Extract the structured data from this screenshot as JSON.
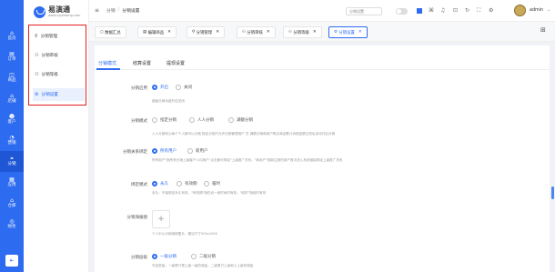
{
  "rail": {
    "items": [
      {
        "icon": "⌂",
        "label": "首页"
      },
      {
        "icon": "▤",
        "label": "订单"
      },
      {
        "icon": "◫",
        "label": "商品"
      },
      {
        "icon": "⌂",
        "label": "店铺"
      },
      {
        "icon": "☻",
        "label": "客户"
      },
      {
        "icon": "◔",
        "label": "营销"
      },
      {
        "icon": "⚭",
        "label": "分销"
      },
      {
        "icon": "▦",
        "label": "应用"
      },
      {
        "icon": "⌂",
        "label": "仓库"
      },
      {
        "icon": "◎",
        "label": "财务"
      }
    ],
    "bottom": "⇤"
  },
  "logo": {
    "title": "易演通",
    "sub": "www.yiyantong.com"
  },
  "sidebar": {
    "items": [
      {
        "icon": "⚲",
        "label": "分销管理"
      },
      {
        "icon": "⚇",
        "label": "分销审核"
      },
      {
        "icon": "⚇",
        "label": "分销等级"
      },
      {
        "icon": "⚙",
        "label": "分销设置"
      }
    ]
  },
  "topbar": {
    "menu_icon": "≡",
    "breadcrumb": [
      "分销",
      "分销设置"
    ],
    "search_placeholder": "分销设置",
    "user": "admin"
  },
  "tabs": [
    "数据汇总",
    "编辑商品",
    "分销管理",
    "分销审核",
    "分销等级",
    "分销设置"
  ],
  "page_tabs": [
    "分销模式",
    "结算设置",
    "提现设置"
  ],
  "form": {
    "enable": {
      "label": "分销启用",
      "options": [
        "开启",
        "关闭"
      ],
      "hint": "超级分销功能开启关闭"
    },
    "mode": {
      "label": "分销模式",
      "options": [
        "指定分销",
        "人人分销",
        "满额分销"
      ],
      "hint": "人人分销则公每个个人都可以分销 指定分销只允许分销管理用户 员 满额分销商用户购买商品累计消费金额达到后自动开启分销"
    },
    "relation": {
      "label": "分销关系绑定",
      "options": [
        "所有用户",
        "新用户"
      ],
      "hint": "所有用户\"指所有分销上级客户人均用户\"点击都可绑定\"上级推广关系，\"新用户\"指新注册的用户首次进入系统链接绑定上级推广关系"
    },
    "bind": {
      "label": "绑定模式",
      "options": [
        "永久",
        "有效期",
        "临时"
      ],
      "hint": "永久：不保绑定永久有效，\"有效期\"指在设一段时间内有效，\"临时\"指临时有效"
    },
    "poster": {
      "label": "分销海报图",
      "hint": "个人中心分销海报图片，建议尺寸500x1000",
      "upload_icon": "+"
    },
    "level": {
      "label": "分销层级",
      "options": [
        "一级分销",
        "二级分销"
      ],
      "hint": "开启层级，一级是只是上级一级的佣金，二级是只上级和上上级的佣金"
    }
  },
  "colors": {
    "primary": "#2d6bf0",
    "highlight": "#e32020"
  }
}
